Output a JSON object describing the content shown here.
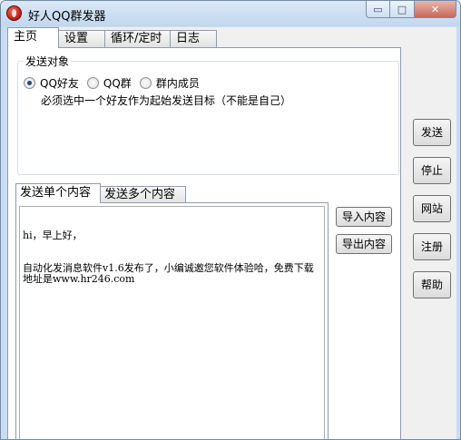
{
  "window": {
    "title": "好人QQ群发器",
    "close_glyph": "✕",
    "min_glyph": "▭",
    "max_glyph": "□"
  },
  "tabs": [
    {
      "label": "主页",
      "active": true
    },
    {
      "label": "设置",
      "active": false
    },
    {
      "label": "循环/定时",
      "active": false
    },
    {
      "label": "日志",
      "active": false
    }
  ],
  "send_target": {
    "group_title": "发送对象",
    "options": [
      {
        "label": "QQ好友",
        "selected": true
      },
      {
        "label": "QQ群",
        "selected": false
      },
      {
        "label": "群内成员",
        "selected": false
      }
    ],
    "hint": "必须选中一个好友作为起始发送目标（不能是自己）"
  },
  "content_tabs": [
    {
      "label": "发送单个内容",
      "active": true
    },
    {
      "label": "发送多个内容",
      "active": false
    }
  ],
  "message": {
    "lines": [
      "hi，早上好，",
      "自动化发消息软件v1.6发布了，小编诚邀您软件体验哈，免费下载地址是www.hr246.com"
    ]
  },
  "content_buttons": {
    "import": "导入内容",
    "export": "导出内容"
  },
  "side_buttons": {
    "send": "发送",
    "stop": "停止",
    "website": "网站",
    "register": "注册",
    "help": "帮助"
  }
}
